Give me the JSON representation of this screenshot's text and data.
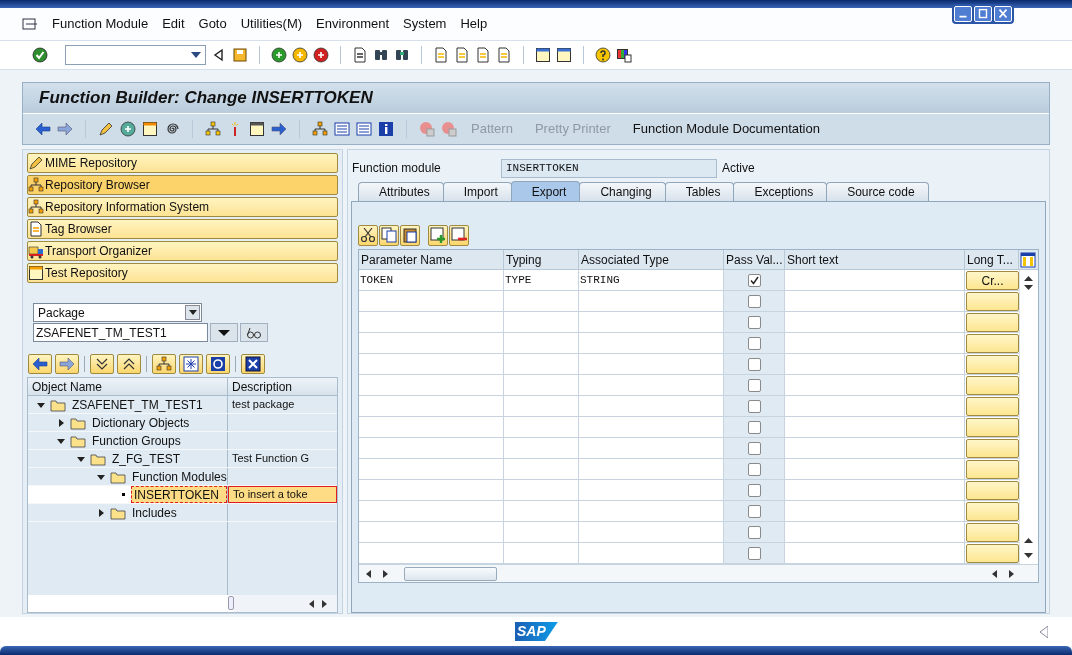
{
  "menu_bar": [
    "Function Module",
    "Edit",
    "Goto",
    "Utilities(M)",
    "Environment",
    "System",
    "Help"
  ],
  "screen_title": "Function Builder: Change INSERTTOKEN",
  "app_toolbar": [
    {
      "label": "Pattern",
      "disabled": true
    },
    {
      "label": "Pretty Printer",
      "disabled": true
    },
    {
      "label": "Function Module Documentation",
      "disabled": false
    }
  ],
  "navigation_buttons": [
    {
      "label": "MIME Repository",
      "selected": false
    },
    {
      "label": "Repository Browser",
      "selected": true
    },
    {
      "label": "Repository Information System",
      "selected": false
    },
    {
      "label": "Tag Browser",
      "selected": false
    },
    {
      "label": "Transport Organizer",
      "selected": false
    },
    {
      "label": "Test Repository",
      "selected": false
    }
  ],
  "object_type_dropdown": "Package",
  "object_name_field": "ZSAFENET_TM_TEST1",
  "tree": {
    "columns": [
      "Object Name",
      "Description"
    ],
    "nodes": [
      {
        "name": "ZSAFENET_TM_TEST1",
        "description": "test package",
        "expanded": true,
        "selected": false,
        "children": [
          {
            "name": "Dictionary Objects",
            "expanded": false,
            "selected": false
          },
          {
            "name": "Function Groups",
            "expanded": true,
            "selected": false,
            "children": [
              {
                "name": "Z_FG_TEST",
                "description": "Test Function G",
                "expanded": true,
                "selected": false,
                "children": [
                  {
                    "name": "Function Modules",
                    "expanded": true,
                    "selected": false,
                    "children": [
                      {
                        "name": "INSERTTOKEN",
                        "description": "To insert a toke",
                        "selected": true
                      }
                    ]
                  },
                  {
                    "name": "Includes",
                    "expanded": false,
                    "selected": false
                  }
                ]
              }
            ]
          }
        ]
      }
    ]
  },
  "function_module": {
    "label": "Function module",
    "value": "INSERTTOKEN",
    "status": "Active"
  },
  "tabs": [
    {
      "label": "Attributes",
      "selected": false
    },
    {
      "label": "Import",
      "selected": false
    },
    {
      "label": "Export",
      "selected": true
    },
    {
      "label": "Changing",
      "selected": false
    },
    {
      "label": "Tables",
      "selected": false
    },
    {
      "label": "Exceptions",
      "selected": false
    },
    {
      "label": "Source code",
      "selected": false
    }
  ],
  "table": {
    "columns": [
      "Parameter Name",
      "Typing",
      "Associated Type",
      "Pass Val...",
      "Short text",
      "Long T..."
    ],
    "rows": [
      {
        "parameter_name": "TOKEN",
        "typing": "TYPE",
        "associated_type": "STRING",
        "pass_value": true,
        "long_text": "Cr..."
      },
      {
        "pass_value": false
      },
      {
        "pass_value": false
      },
      {
        "pass_value": false
      },
      {
        "pass_value": false
      },
      {
        "pass_value": false
      },
      {
        "pass_value": false
      },
      {
        "pass_value": false
      },
      {
        "pass_value": false
      },
      {
        "pass_value": false
      },
      {
        "pass_value": false
      },
      {
        "pass_value": false
      },
      {
        "pass_value": false
      },
      {
        "pass_value": false
      }
    ]
  },
  "status_bar": {
    "logo": "SAP"
  }
}
